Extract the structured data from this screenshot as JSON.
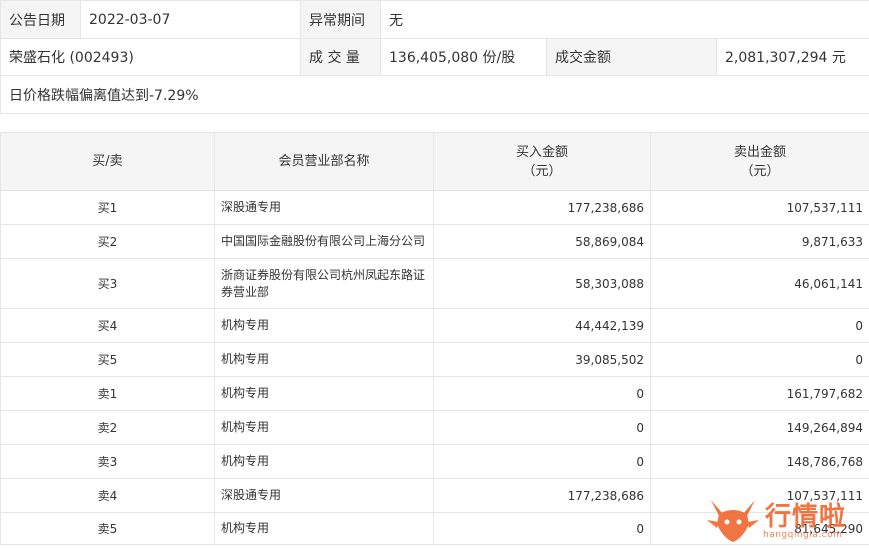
{
  "info": {
    "date_label": "公告日期",
    "date_value": "2022-03-07",
    "period_label": "异常期间",
    "period_value": "无",
    "stock_name": "荣盛石化 (002493)",
    "volume_label": "成 交 量",
    "volume_value": "136,405,080 份/股",
    "amount_label": "成交金额",
    "amount_value": "2,081,307,294 元",
    "reason": "日价格跌幅偏离值达到-7.29%"
  },
  "table": {
    "headers": {
      "side": "买/卖",
      "broker": "会员营业部名称",
      "buy_line1": "买入金额",
      "buy_line2": "（元）",
      "sell_line1": "卖出金额",
      "sell_line2": "（元）"
    },
    "rows": [
      {
        "side": "买1",
        "broker": "深股通专用",
        "buy": "177,238,686",
        "sell": "107,537,111"
      },
      {
        "side": "买2",
        "broker": "中国国际金融股份有限公司上海分公司",
        "buy": "58,869,084",
        "sell": "9,871,633"
      },
      {
        "side": "买3",
        "broker": "浙商证券股份有限公司杭州凤起东路证券营业部",
        "buy": "58,303,088",
        "sell": "46,061,141"
      },
      {
        "side": "买4",
        "broker": "机构专用",
        "buy": "44,442,139",
        "sell": "0"
      },
      {
        "side": "买5",
        "broker": "机构专用",
        "buy": "39,085,502",
        "sell": "0"
      },
      {
        "side": "卖1",
        "broker": "机构专用",
        "buy": "0",
        "sell": "161,797,682"
      },
      {
        "side": "卖2",
        "broker": "机构专用",
        "buy": "0",
        "sell": "149,264,894"
      },
      {
        "side": "卖3",
        "broker": "机构专用",
        "buy": "0",
        "sell": "148,786,768"
      },
      {
        "side": "卖4",
        "broker": "深股通专用",
        "buy": "177,238,686",
        "sell": "107,537,111"
      },
      {
        "side": "卖5",
        "broker": "机构专用",
        "buy": "0",
        "sell": "81,645,290"
      }
    ]
  },
  "watermark": {
    "brand": "行情啦",
    "domain": "hangqingla.com",
    "color": "#f0632a"
  }
}
